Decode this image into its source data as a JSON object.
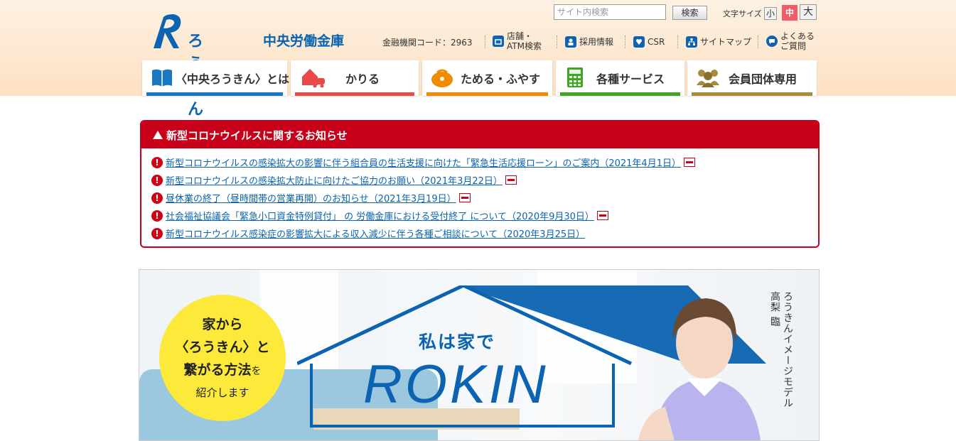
{
  "header": {
    "logo_text": "ろうきん",
    "bank_name": "中央労働金庫",
    "institution_code": "金融機関コード：2963",
    "utility_links": [
      {
        "label": "店舗・ATM検索",
        "icon": "store-icon"
      },
      {
        "label": "採用情報",
        "icon": "person-icon"
      },
      {
        "label": "CSR",
        "icon": "heart-icon"
      },
      {
        "label": "サイトマップ",
        "icon": "sitemap-icon"
      },
      {
        "label": "よくあるご質問",
        "icon": "chat-icon"
      }
    ],
    "search_placeholder": "サイト内検索",
    "search_button": "検索",
    "font_size_label": "文字サイズ",
    "font_sizes": [
      "小",
      "中",
      "大"
    ]
  },
  "nav": [
    {
      "label": "〈中央ろうきん〉とは",
      "color": "#1a78c2",
      "icon": "book-icon"
    },
    {
      "label": "かりる",
      "color": "#e84a4a",
      "icon": "house-car-icon"
    },
    {
      "label": "ためる・ふやす",
      "color": "#f08a00",
      "icon": "wallet-icon"
    },
    {
      "label": "各種サービス",
      "color": "#43a324",
      "icon": "calculator-icon"
    },
    {
      "label": "会員団体専用",
      "color": "#a88a3c",
      "icon": "group-icon"
    }
  ],
  "notice": {
    "title": "新型コロナウイルスに関するお知らせ",
    "items": [
      {
        "text": "新型コロナウイルスの感染拡大の影響に伴う組合員の生活支援に向けた「緊急生活応援ローン」のご案内（2021年4月1日）",
        "pdf": true
      },
      {
        "text": "新型コロナウイルスの感染拡大防止に向けたご協力のお願い（2021年3月22日）",
        "pdf": true
      },
      {
        "text": "昼休業の終了（昼時間帯の営業再開）のお知らせ（2021年3月19日）",
        "pdf": true
      },
      {
        "text": "社会福祉協議会「緊急小口資金特例貸付」 の 労働金庫における受付終了 について（2020年9月30日）",
        "pdf": true
      },
      {
        "text": "新型コロナウイルス感染症の影響拡大による収入減少に伴う各種ご相談について（2020年3月25日）",
        "pdf": false
      }
    ]
  },
  "banner": {
    "circle_line1": "家から",
    "circle_line2": "〈ろうきん〉と",
    "circle_line3": "繋がる方法",
    "circle_line3_suffix": "を",
    "circle_line4": "紹介します",
    "tagline": "私は家で",
    "brand": "ROKIN",
    "model_caption": "ろうきんイメージモデル",
    "model_name": "高梨 臨"
  }
}
